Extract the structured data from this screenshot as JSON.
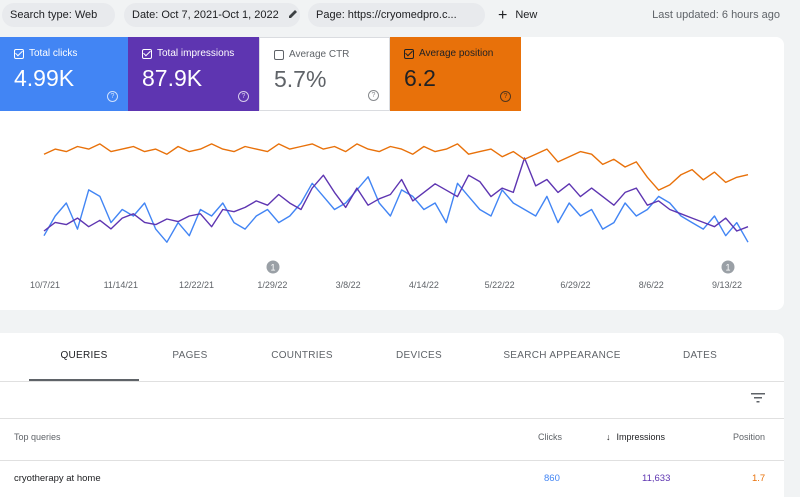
{
  "topbar": {
    "chips": [
      {
        "label": "Search type: Web"
      },
      {
        "label": "Date: Oct 7, 2021-Oct 1, 2022"
      },
      {
        "label": "Page: https://cryomedpro.c..."
      }
    ],
    "new_label": "New",
    "last_updated": "Last updated: 6 hours ago"
  },
  "metrics": [
    {
      "label": "Total clicks",
      "value": "4.99K",
      "checked": true
    },
    {
      "label": "Total impressions",
      "value": "87.9K",
      "checked": true
    },
    {
      "label": "Average CTR",
      "value": "5.7%",
      "checked": false
    },
    {
      "label": "Average position",
      "value": "6.2",
      "checked": true
    }
  ],
  "chart_data": {
    "type": "line",
    "x_ticks": [
      "10/7/21",
      "11/14/21",
      "12/22/21",
      "1/29/22",
      "3/8/22",
      "4/14/22",
      "5/22/22",
      "6/29/22",
      "8/6/22",
      "9/13/22"
    ],
    "annotations": [
      {
        "label": "1",
        "near": "1/29/22"
      },
      {
        "label": "1",
        "near": "9/13/22"
      }
    ],
    "series": [
      {
        "name": "Total clicks",
        "color": "#4285f4",
        "values": [
          10,
          13,
          15,
          11,
          17,
          16,
          12,
          14,
          13,
          15,
          11,
          9,
          12,
          10,
          14,
          13,
          15,
          12,
          11,
          13,
          14,
          12,
          13,
          15,
          18,
          16,
          14,
          15,
          17,
          19,
          15,
          13,
          17,
          16,
          14,
          15,
          12,
          18,
          16,
          14,
          13,
          17,
          15,
          14,
          13,
          16,
          12,
          15,
          13,
          14,
          11,
          12,
          15,
          13,
          14,
          16,
          15,
          13,
          12,
          11,
          13,
          10,
          12,
          9
        ]
      },
      {
        "name": "Total impressions",
        "color": "#5e35b1",
        "values": [
          290,
          310,
          305,
          320,
          300,
          315,
          295,
          320,
          330,
          310,
          305,
          318,
          312,
          325,
          330,
          300,
          340,
          335,
          345,
          360,
          350,
          375,
          355,
          340,
          390,
          420,
          380,
          345,
          390,
          350,
          365,
          375,
          410,
          360,
          380,
          400,
          385,
          370,
          420,
          405,
          370,
          390,
          380,
          460,
          395,
          410,
          380,
          400,
          370,
          390,
          370,
          350,
          380,
          390,
          350,
          360,
          340,
          330,
          320,
          310,
          300,
          320,
          290,
          300
        ]
      },
      {
        "name": "Average position",
        "color": "#e8710a",
        "values": [
          5.4,
          5.2,
          5.3,
          5.1,
          5.2,
          5.0,
          5.3,
          5.2,
          5.1,
          5.3,
          5.2,
          5.4,
          5.1,
          5.3,
          5.2,
          5.0,
          5.2,
          5.3,
          5.1,
          5.2,
          5.3,
          5.0,
          5.2,
          5.1,
          5.0,
          5.2,
          5.1,
          5.3,
          5.0,
          5.2,
          5.3,
          5.1,
          5.2,
          5.4,
          5.1,
          5.3,
          5.2,
          5.0,
          5.4,
          5.3,
          5.2,
          5.5,
          5.3,
          5.6,
          5.4,
          5.2,
          5.7,
          5.5,
          5.3,
          5.4,
          5.8,
          5.6,
          5.9,
          5.7,
          6.3,
          6.8,
          6.6,
          6.2,
          6.0,
          6.4,
          6.1,
          6.5,
          6.3,
          6.2
        ]
      }
    ]
  },
  "tabs": [
    "QUERIES",
    "PAGES",
    "COUNTRIES",
    "DEVICES",
    "SEARCH APPEARANCE",
    "DATES"
  ],
  "table": {
    "headers": {
      "query": "Top queries",
      "clicks": "Clicks",
      "impressions": "Impressions",
      "position": "Position"
    },
    "rows": [
      {
        "query": "cryotherapy at home",
        "clicks": "860",
        "impressions": "11,633",
        "position": "1.7"
      }
    ]
  },
  "colors": {
    "clicks": "#4285f4",
    "impressions": "#5e35b1",
    "position": "#e8710a"
  }
}
